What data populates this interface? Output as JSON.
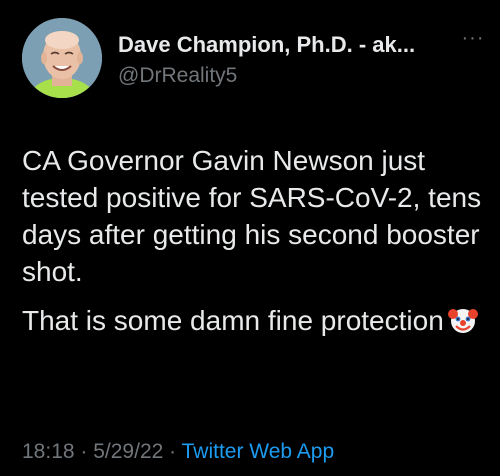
{
  "author": {
    "display_name": "Dave Champion, Ph.D. - ak...",
    "handle": "@DrReality5"
  },
  "tweet": {
    "paragraph_1": "CA Governor Gavin Newson just tested positive for SARS-CoV-2, tens days after getting his second booster shot.",
    "paragraph_2": "That is some damn fine protection",
    "emoji": "clown-face-icon"
  },
  "meta": {
    "time": "18:18",
    "separator_1": " · ",
    "date": "5/29/22",
    "separator_2": " · ",
    "source": "Twitter Web App"
  },
  "menu": {
    "more_label": "···"
  },
  "colors": {
    "background": "#000000",
    "text": "#e7e9ea",
    "secondary": "#71767b",
    "link": "#1d9bf0"
  }
}
